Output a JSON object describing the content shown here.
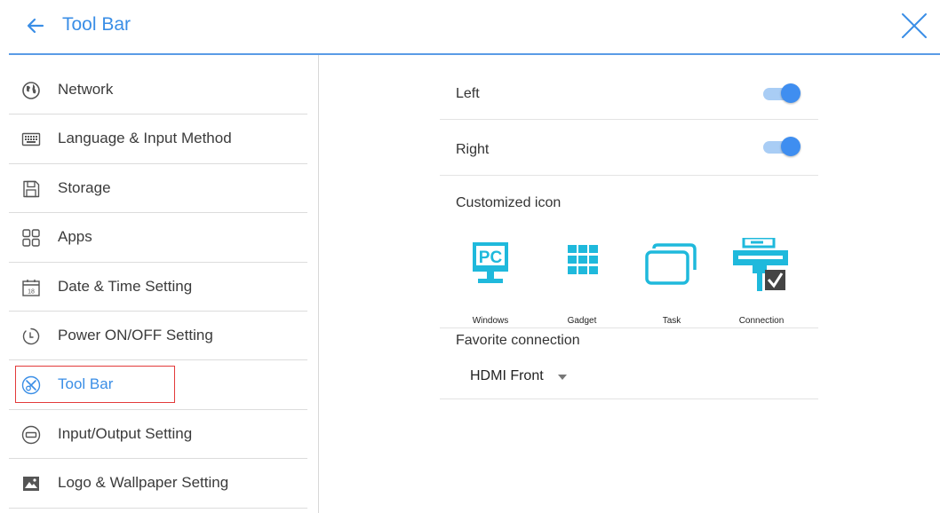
{
  "header": {
    "title": "Tool Bar"
  },
  "sidebar": {
    "items": [
      {
        "label": "Network",
        "icon": "globe-icon"
      },
      {
        "label": "Language & Input Method",
        "icon": "keyboard-icon"
      },
      {
        "label": "Storage",
        "icon": "storage-icon"
      },
      {
        "label": "Apps",
        "icon": "apps-icon"
      },
      {
        "label": "Date & Time Setting",
        "icon": "calendar-icon"
      },
      {
        "label": "Power ON/OFF Setting",
        "icon": "power-icon"
      },
      {
        "label": "Tool Bar",
        "icon": "toolbar-icon",
        "active": true
      },
      {
        "label": "Input/Output Setting",
        "icon": "input-output-icon"
      },
      {
        "label": "Logo & Wallpaper Setting",
        "icon": "wallpaper-icon"
      }
    ],
    "calendar_day": "18"
  },
  "main": {
    "left": {
      "label": "Left",
      "enabled": true
    },
    "right": {
      "label": "Right",
      "enabled": true
    },
    "customized_icon": {
      "label": "Customized icon",
      "icons": [
        {
          "caption": "Windows",
          "icon": "pc-monitor-icon",
          "glyph_text": "PC"
        },
        {
          "caption": "Gadget",
          "icon": "gadget-grid-icon"
        },
        {
          "caption": "Task",
          "icon": "task-windows-icon"
        },
        {
          "caption": "Connection",
          "icon": "connection-icon",
          "selected": true
        }
      ]
    },
    "favorite_connection": {
      "label": "Favorite connection",
      "value": "HDMI Front"
    }
  },
  "colors": {
    "accent": "#3a8ee6",
    "icon_cyan": "#1fb9dc",
    "toggle_on": "#3f8ef0",
    "highlight_box": "#e33a3a"
  }
}
